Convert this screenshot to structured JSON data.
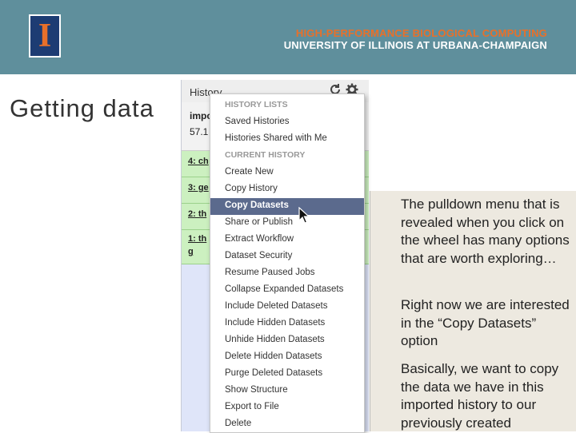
{
  "banner": {
    "logo_letter": "I",
    "line1": "HIGH-PERFORMANCE BIOLOGICAL COMPUTING",
    "line2": "UNIVERSITY OF ILLINOIS AT URBANA-CHAMPAIGN",
    "colors": {
      "bar": "#5f8f9c",
      "accent": "#e8702a",
      "logo_bg": "#1d3c73"
    }
  },
  "slide": {
    "title": "Getting data"
  },
  "history": {
    "title": "History",
    "summary_name": "impo",
    "summary_size": "57.1",
    "datasets": [
      "4: ch",
      "3: ge",
      "2: th",
      "1: th",
      "g"
    ]
  },
  "menu": {
    "items": [
      "HISTORY LISTS",
      "Saved Histories",
      "Histories Shared with Me",
      "CURRENT HISTORY",
      "Create New",
      "Copy History",
      "Copy Datasets",
      "Share or Publish",
      "Extract Workflow",
      "Dataset Security",
      "Resume Paused Jobs",
      "Collapse Expanded Datasets",
      "Include Deleted Datasets",
      "Include Hidden Datasets",
      "Unhide Hidden Datasets",
      "Delete Hidden Datasets",
      "Purge Deleted Datasets",
      "Show Structure",
      "Export to File",
      "Delete"
    ],
    "active_item": "Copy Datasets",
    "active_color": "#5b6a8d"
  },
  "callout": {
    "p1": "The pulldown menu that is revealed when you click on the wheel has many options that are worth exploring…",
    "p2": "Right now we are interested in the “Copy Datasets” option",
    "p3": "Basically, we want to copy the data we have in this imported history to our previously created"
  }
}
